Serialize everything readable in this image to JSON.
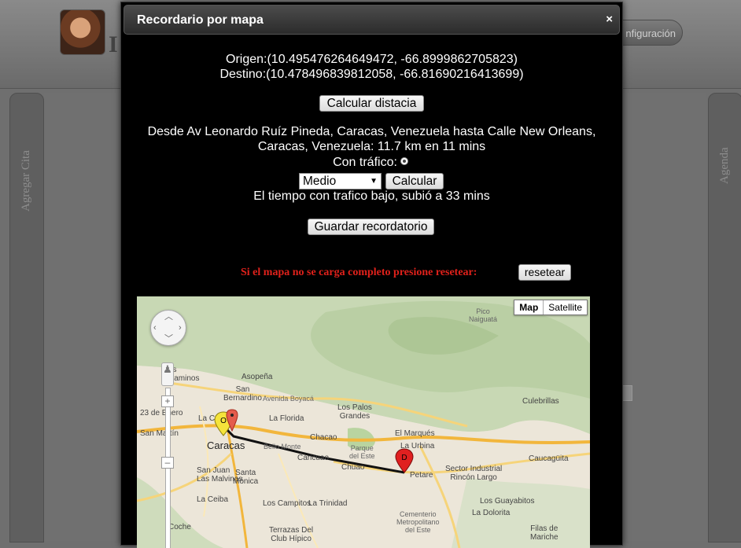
{
  "background": {
    "config_button": "nfiguración",
    "left_panel": "Agregar Cita",
    "right_panel": "Agenda",
    "page_letter": "I"
  },
  "modal": {
    "title": "Recordario por mapa",
    "close": "×",
    "origin": "Origen:(10.495476264649472, -66.8999862705823)",
    "destination": "Destino:(10.478496839812058, -66.81690216413699)",
    "calc_distance_button": "Calcular distacia",
    "route_line1": "Desde Av Leonardo Ruíz Pineda, Caracas, Venezuela hasta Calle New Orleans,",
    "route_line2": "Caracas, Venezuela: 11.7 km en 11 mins",
    "traffic_label": "Con tráfico:",
    "traffic_select": "Medio",
    "calculate_button": "Calcular",
    "traffic_result": "El tiempo con trafico bajo, subió a 33 mins",
    "save_button": "Guardar recordatorio",
    "reset_warning": "Si el mapa no se carga completo presione resetear:",
    "reset_button": "resetear"
  },
  "map": {
    "type_map": "Map",
    "type_satellite": "Satellite",
    "marker_origin": "O",
    "marker_destination": "D",
    "labels": {
      "pico_naiguata": "Pico\nNaiguatá",
      "culebrillas": "Culebrillas",
      "asopena": "Asopeña",
      "san_bernardino": "San\nBernardino",
      "avenida_boyaca": "Avenida Boyacá",
      "los_palos_grandes": "Los Palos\nGrandes",
      "la_florida": "La Florida",
      "chacao": "Chacao",
      "el_marques": "El Marqués",
      "la_urbina": "La Urbina",
      "caracas": "Caracas",
      "bello_monte": "Bello Monte",
      "parque_del_este": "Parque\ndel Este",
      "san_martin": "San Martín",
      "caricuao": "Caricuao",
      "chuao": "Chuao",
      "petare": "Petare",
      "caucaguita": "Caucagüita",
      "sector_industrial": "Sector Industrial\nRincón Largo",
      "las_malvinas": "San Juan\nLas Malvinas",
      "santa_monica": "Santa\nMónica",
      "la_ceiba": "La Ceiba",
      "los_campitos": "Los Campitos",
      "la_trinidad": "La Trinidad",
      "cochel": "Coche",
      "terrazas": "Terrazas Del\nClub Hípico",
      "cementerio": "Cementerio\nMetropolitano\ndel Este",
      "los_guayabitos": "Los Guayabitos",
      "la_dolorita": "La Dolorita",
      "filas_mariche": "Filas de\nMariche",
      "23_enero": "23 de Enero",
      "la_colina": "La Colina",
      "los_dos_caminos": "os\nCaminos"
    }
  }
}
